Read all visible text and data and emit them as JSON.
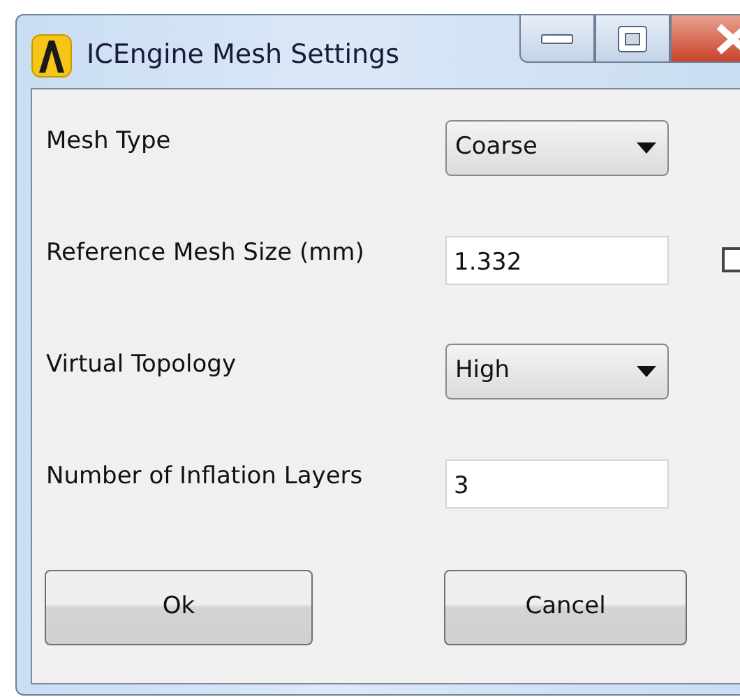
{
  "window": {
    "title": "ICEngine Mesh Settings"
  },
  "fields": [
    {
      "label": "Mesh Type",
      "kind": "dropdown",
      "value": "Coarse"
    },
    {
      "label": "Reference Mesh Size (mm)",
      "kind": "input",
      "value": "1.332",
      "checkbox": {
        "checked": false
      }
    },
    {
      "label": "Virtual Topology",
      "kind": "dropdown",
      "value": "High"
    },
    {
      "label": "Number of Inflation Layers",
      "kind": "input",
      "value": "3"
    }
  ],
  "buttons": [
    "Ok",
    "Cancel"
  ]
}
